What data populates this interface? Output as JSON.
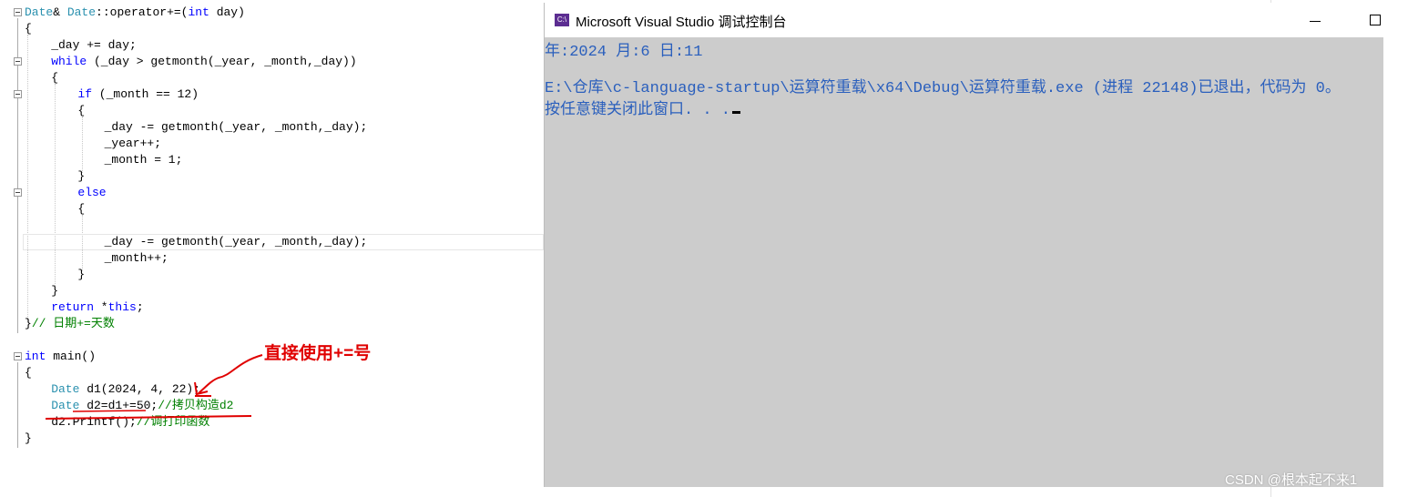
{
  "editor": {
    "lines": [
      {
        "y": 0,
        "indent": 0,
        "parts": [
          {
            "c": "ty",
            "t": "Date"
          },
          {
            "c": "nm",
            "t": "& "
          },
          {
            "c": "ty",
            "t": "Date"
          },
          {
            "c": "nm",
            "t": "::"
          },
          {
            "c": "fn",
            "t": "operator+="
          },
          {
            "c": "nm",
            "t": "("
          },
          {
            "c": "kw",
            "t": "int"
          },
          {
            "c": "nm",
            "t": " day)"
          }
        ]
      },
      {
        "y": 1,
        "indent": 0,
        "parts": [
          {
            "c": "nm",
            "t": "{"
          }
        ]
      },
      {
        "y": 2,
        "indent": 4,
        "parts": [
          {
            "c": "nm",
            "t": "_day += day;"
          }
        ]
      },
      {
        "y": 3,
        "indent": 4,
        "parts": [
          {
            "c": "kw",
            "t": "while"
          },
          {
            "c": "nm",
            "t": " (_day > getmonth(_year, _month,_day))"
          }
        ]
      },
      {
        "y": 4,
        "indent": 4,
        "parts": [
          {
            "c": "nm",
            "t": "{"
          }
        ]
      },
      {
        "y": 5,
        "indent": 8,
        "parts": [
          {
            "c": "kw",
            "t": "if"
          },
          {
            "c": "nm",
            "t": " (_month == 12)"
          }
        ]
      },
      {
        "y": 6,
        "indent": 8,
        "parts": [
          {
            "c": "nm",
            "t": "{"
          }
        ]
      },
      {
        "y": 7,
        "indent": 12,
        "parts": [
          {
            "c": "nm",
            "t": "_day -= getmonth(_year, _month,_day);"
          }
        ]
      },
      {
        "y": 8,
        "indent": 12,
        "parts": [
          {
            "c": "nm",
            "t": "_year++;"
          }
        ]
      },
      {
        "y": 9,
        "indent": 12,
        "parts": [
          {
            "c": "nm",
            "t": "_month = 1;"
          }
        ]
      },
      {
        "y": 10,
        "indent": 8,
        "parts": [
          {
            "c": "nm",
            "t": "}"
          }
        ]
      },
      {
        "y": 11,
        "indent": 8,
        "parts": [
          {
            "c": "kw",
            "t": "else"
          }
        ]
      },
      {
        "y": 12,
        "indent": 8,
        "parts": [
          {
            "c": "nm",
            "t": "{"
          }
        ]
      },
      {
        "y": 14,
        "indent": 12,
        "parts": [
          {
            "c": "nm",
            "t": "_day -= getmonth(_year, _month,_day);"
          }
        ]
      },
      {
        "y": 15,
        "indent": 12,
        "parts": [
          {
            "c": "nm",
            "t": "_month++;"
          }
        ]
      },
      {
        "y": 16,
        "indent": 8,
        "parts": [
          {
            "c": "nm",
            "t": "}"
          }
        ]
      },
      {
        "y": 17,
        "indent": 4,
        "parts": [
          {
            "c": "nm",
            "t": "}"
          }
        ]
      },
      {
        "y": 18,
        "indent": 4,
        "parts": [
          {
            "c": "kw",
            "t": "return"
          },
          {
            "c": "nm",
            "t": " *"
          },
          {
            "c": "kw",
            "t": "this"
          },
          {
            "c": "nm",
            "t": ";"
          }
        ]
      },
      {
        "y": 19,
        "indent": 0,
        "parts": [
          {
            "c": "nm",
            "t": "}"
          },
          {
            "c": "cm",
            "t": "// 日期+=天数"
          }
        ]
      },
      {
        "y": 21,
        "indent": 0,
        "parts": [
          {
            "c": "kw",
            "t": "int"
          },
          {
            "c": "nm",
            "t": " main()"
          }
        ]
      },
      {
        "y": 22,
        "indent": 0,
        "parts": [
          {
            "c": "nm",
            "t": "{"
          }
        ]
      },
      {
        "y": 23,
        "indent": 4,
        "parts": [
          {
            "c": "ty",
            "t": "Date"
          },
          {
            "c": "nm",
            "t": " d1(2024, 4, 22);"
          }
        ]
      },
      {
        "y": 24,
        "indent": 4,
        "parts": [
          {
            "c": "ty",
            "t": "Date"
          },
          {
            "c": "nm",
            "t": " d2=d1+=50;"
          },
          {
            "c": "cm",
            "t": "//拷贝构造d2"
          }
        ]
      },
      {
        "y": 25,
        "indent": 4,
        "parts": [
          {
            "c": "nm",
            "t": "d2.Printf();"
          },
          {
            "c": "cm",
            "t": "//调打印函数"
          }
        ]
      },
      {
        "y": 26,
        "indent": 0,
        "parts": [
          {
            "c": "nm",
            "t": "}"
          }
        ]
      }
    ],
    "annotation": "直接使用+=号"
  },
  "console": {
    "title": "Microsoft Visual Studio 调试控制台",
    "icon": "C:\\",
    "output_line1": "年:2024 月:6 日:11",
    "output_line2": "E:\\仓库\\c-language-startup\\运算符重载\\x64\\Debug\\运算符重载.exe (进程 22148)已退出，代码为 0。",
    "output_line3": "按任意键关闭此窗口. . ."
  },
  "watermark": "CSDN @根本起不来1"
}
